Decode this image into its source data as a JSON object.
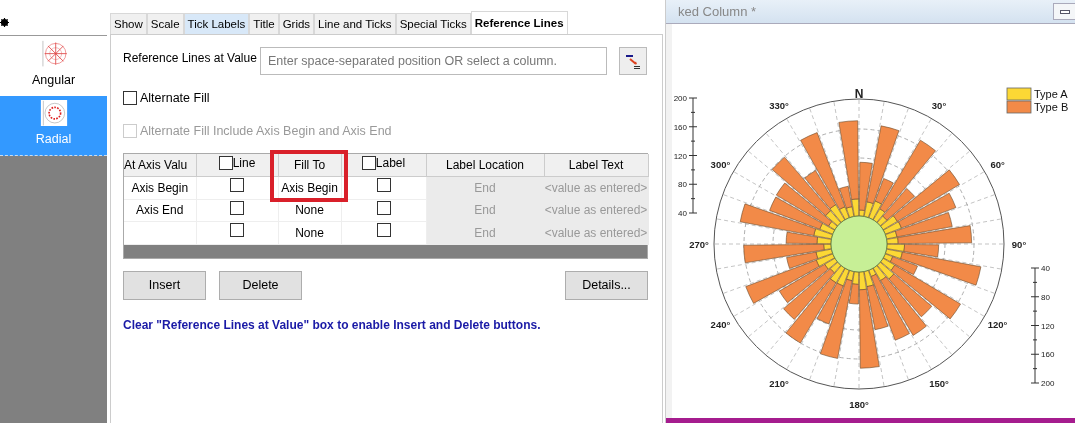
{
  "sidebar": {
    "items": [
      {
        "label": "Angular",
        "kind": "angular",
        "selected": false
      },
      {
        "label": "Radial",
        "kind": "radial",
        "selected": true
      }
    ]
  },
  "tabs": [
    {
      "label": "Show",
      "selected": false,
      "hovered": false
    },
    {
      "label": "Scale",
      "selected": false,
      "hovered": false
    },
    {
      "label": "Tick Labels",
      "selected": false,
      "hovered": true
    },
    {
      "label": "Title",
      "selected": false,
      "hovered": false
    },
    {
      "label": "Grids",
      "selected": false,
      "hovered": false
    },
    {
      "label": "Line and Ticks",
      "selected": false,
      "hovered": false
    },
    {
      "label": "Special Ticks",
      "selected": false,
      "hovered": false
    },
    {
      "label": "Reference Lines",
      "selected": true,
      "hovered": false
    }
  ],
  "reference_value": {
    "label": "Reference Lines at Value",
    "placeholder": "Enter space-separated position OR select a column."
  },
  "options": [
    {
      "label": "Alternate Fill",
      "checked": false,
      "disabled": false
    },
    {
      "label": "Alternate Fill Include Axis Begin and Axis End",
      "checked": false,
      "disabled": true
    }
  ],
  "table": {
    "columns": [
      {
        "label": "At Axis Valu",
        "checkbox": false,
        "highlighted": false
      },
      {
        "label": "Line",
        "checkbox": true,
        "checked": false,
        "highlighted": false
      },
      {
        "label": "Fill To",
        "checkbox": false,
        "highlighted": true
      },
      {
        "label": "Label",
        "checkbox": true,
        "checked": false,
        "highlighted": false
      },
      {
        "label": "Label Location",
        "checkbox": false,
        "highlighted": false
      },
      {
        "label": "Label Text",
        "checkbox": false,
        "highlighted": false
      }
    ],
    "rows": [
      {
        "at_axis_value": "Axis Begin",
        "line": false,
        "fill_to": "Axis Begin",
        "label": false,
        "label_location": "End",
        "label_text": "<value as entered>"
      },
      {
        "at_axis_value": "Axis End",
        "line": false,
        "fill_to": "None",
        "label": false,
        "label_location": "End",
        "label_text": "<value as entered>"
      },
      {
        "line": false,
        "fill_to": "None",
        "label": false,
        "label_location": "End",
        "label_text": "<value as entered>"
      }
    ]
  },
  "buttons": [
    {
      "label": "Insert"
    },
    {
      "label": "Delete"
    },
    {
      "label": "Details..."
    }
  ],
  "hint": "Clear \"Reference Lines at Value\" box to enable Insert and Delete buttons.",
  "window": {
    "title": "ked Column *"
  },
  "chart": {
    "direction_labels": [
      "N",
      "30°",
      "60°",
      "90°",
      "120°",
      "150°",
      "180°",
      "210°",
      "240°",
      "270°",
      "300°",
      "330°"
    ],
    "left_scale": [
      "200",
      "160",
      "120",
      "80",
      "40"
    ],
    "right_scale": [
      "40",
      "80",
      "120",
      "160",
      "200"
    ],
    "legend": [
      {
        "label": "Type A",
        "color": "#fcd835"
      },
      {
        "label": "Type B",
        "color": "#f28a48"
      }
    ]
  }
}
